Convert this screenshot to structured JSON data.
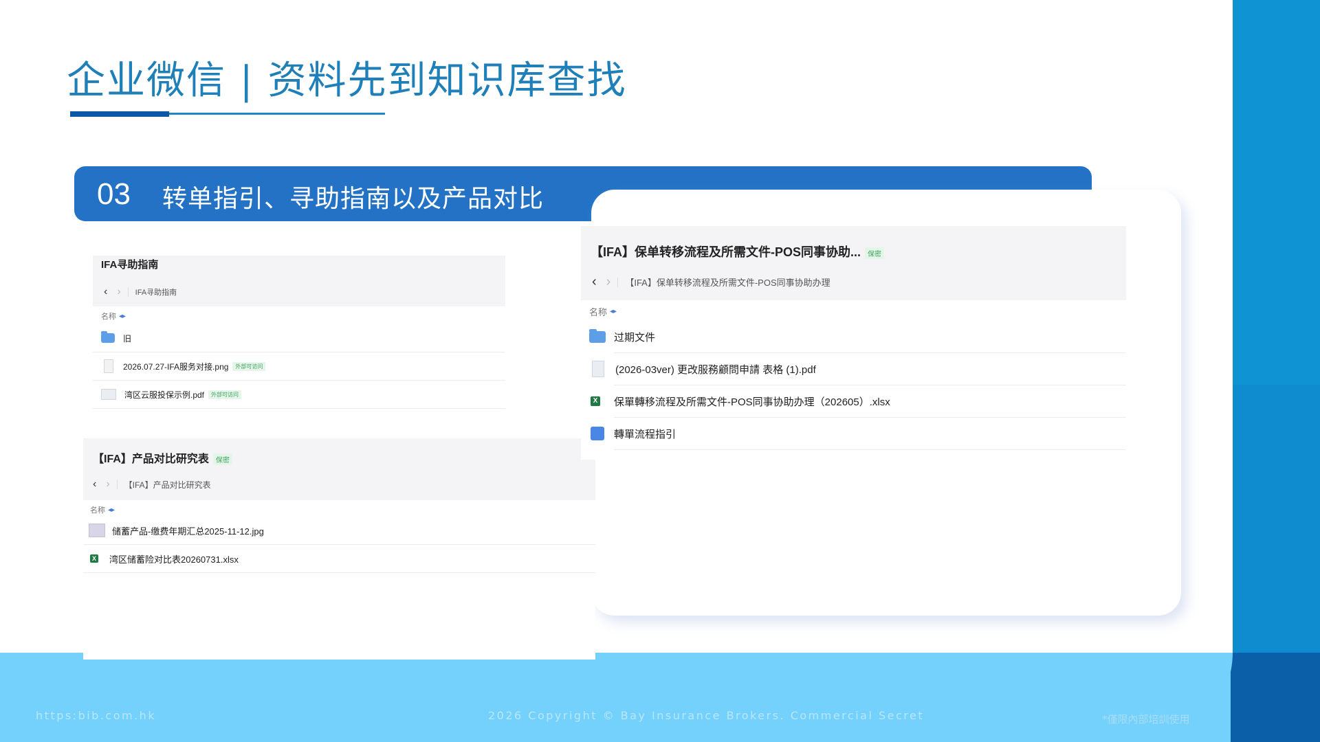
{
  "title": "企业微信 | 资料先到知识库查找",
  "banner": {
    "number": "03",
    "text": "转单指引、寻助指南以及产品对比"
  },
  "panel_ifa": {
    "title": "IFA寻助指南",
    "breadcrumb": "IFA寻助指南",
    "column": "名称",
    "rows": [
      {
        "name": "旧",
        "tag": "",
        "icon": "shared-folder-icon"
      },
      {
        "name": "2026.07.27-IFA服务对接.png",
        "tag": "外部可访问",
        "icon": "image-file-icon"
      },
      {
        "name": "湾区云服投保示例.pdf",
        "tag": "外部可访问",
        "icon": "pdf-file-icon"
      }
    ]
  },
  "panel_compare": {
    "title": "【IFA】产品对比研究表",
    "tag": "保密",
    "breadcrumb": "【IFA】产品对比研究表",
    "column": "名称",
    "rows": [
      {
        "name": "储蓄产品-缴费年期汇总2025-11-12.jpg",
        "icon": "image-file-icon"
      },
      {
        "name": "湾区储蓄险对比表20260731.xlsx",
        "icon": "excel-file-icon"
      }
    ]
  },
  "panel_transfer": {
    "title": "【IFA】保单转移流程及所需文件-POS同事协助...",
    "tag": "保密",
    "breadcrumb": "【IFA】保单转移流程及所需文件-POS同事协助办理",
    "column": "名称",
    "rows": [
      {
        "name": "过期文件",
        "icon": "shared-folder-icon"
      },
      {
        "name": "(2026-03ver) 更改服務顧問申請 表格 (1).pdf",
        "icon": "pdf-file-icon"
      },
      {
        "name": "保單轉移流程及所需文件-POS同事协助办理（202605）.xlsx",
        "icon": "excel-file-icon"
      },
      {
        "name": "轉單流程指引",
        "icon": "doc-icon"
      }
    ]
  },
  "footer": {
    "url": "https:bib.com.hk",
    "copyright": "2026 Copyright © Bay Insurance Brokers. Commercial Secret",
    "note": "*僅限內部培訓使用"
  },
  "colors": {
    "title": "#1f7fb8",
    "banner": "#2372c6",
    "footer": "#74d1fb",
    "side_bar": "#1093d3"
  }
}
